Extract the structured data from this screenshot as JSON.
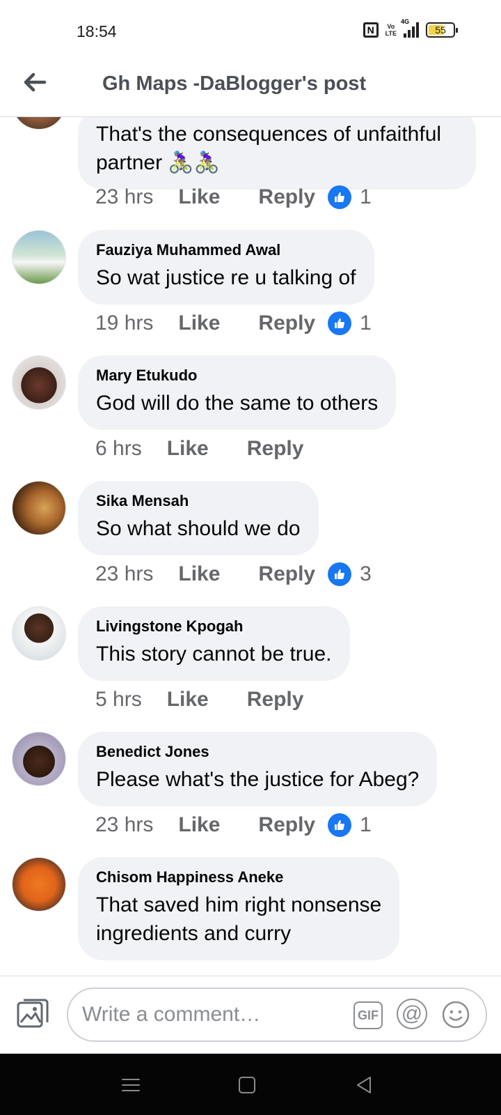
{
  "status_bar": {
    "time": "18:54",
    "nfc_icon": "nfc-icon",
    "volte_top": "Vo",
    "volte_bottom": "LTE",
    "network": "4G",
    "battery": "55"
  },
  "header": {
    "back_icon": "arrow-left-icon",
    "title": "Gh Maps -DaBlogger's post"
  },
  "comments": [
    {
      "author": "",
      "text_line1": "That's the consequences of unfaithful",
      "text_line2": "partner 🚴🏽‍♀️🚴🏽‍♀️",
      "time": "23 hrs",
      "like": "Like",
      "reply": "Reply",
      "reactions": "1"
    },
    {
      "author": "Fauziya Muhammed Awal",
      "text": "So wat justice re u talking of",
      "time": "19 hrs",
      "like": "Like",
      "reply": "Reply",
      "reactions": "1"
    },
    {
      "author": "Mary Etukudo",
      "text": "God will do the same to others",
      "time": "6 hrs",
      "like": "Like",
      "reply": "Reply",
      "reactions": ""
    },
    {
      "author": "Sika Mensah",
      "text": "So what should we do",
      "time": "23 hrs",
      "like": "Like",
      "reply": "Reply",
      "reactions": "3"
    },
    {
      "author": "Livingstone Kpogah",
      "text": "This story cannot be true.",
      "time": "5 hrs",
      "like": "Like",
      "reply": "Reply",
      "reactions": ""
    },
    {
      "author": "Benedict Jones",
      "text": "Please what's the justice for Abeg?",
      "time": "23 hrs",
      "like": "Like",
      "reply": "Reply",
      "reactions": "1"
    },
    {
      "author": "Chisom Happiness Aneke",
      "text_line1": "That saved him right nonsense",
      "text_line2": "ingredients and curry"
    }
  ],
  "composer": {
    "placeholder": "Write a comment…",
    "gif_label": "GIF",
    "at_label": "@"
  },
  "colors": {
    "like_blue": "#1877f2",
    "bubble_bg": "#f0f2f5",
    "meta_gray": "#65676b",
    "header_gray": "#4b4f56"
  }
}
